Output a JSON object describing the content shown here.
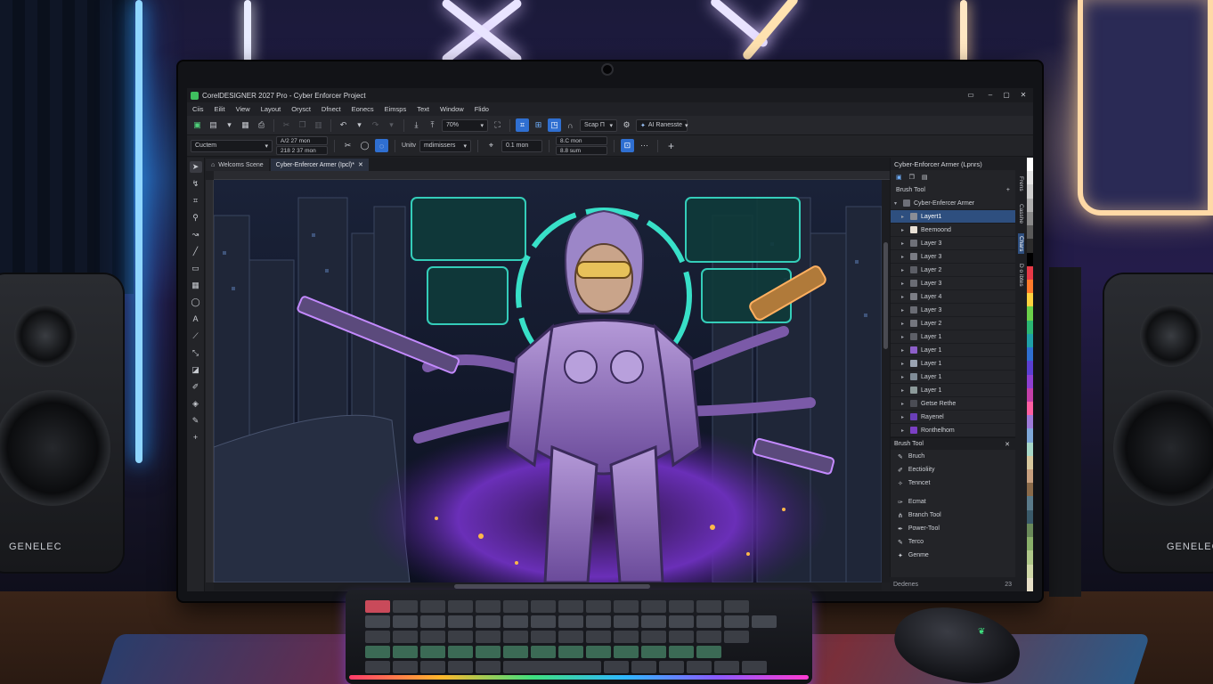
{
  "app": {
    "title": "CorelDESIGNER 2027 Pro - Cyber Enforcer Project",
    "window_controls": [
      "▭",
      "–",
      "▢",
      "✕"
    ]
  },
  "menu": [
    "Ciis",
    "Eilit",
    "View",
    "Layout",
    "Orysct",
    "Dfnect",
    "Eonecs",
    "Eimsps",
    "Text",
    "Window",
    "Flido"
  ],
  "toolbar1": {
    "zoom": "70%",
    "snap": "Scap П",
    "ai_label": "AI Ranesste"
  },
  "toolbar2": {
    "preset": "Cuctem",
    "pos_x": "A/2 27 mon",
    "pos_y": "218 2 37 mon",
    "units_label": "Unitv",
    "units_value": "mdimissers",
    "nudge": "0.1 mon",
    "size_w": "8.C mon",
    "size_h": "8.8 sum"
  },
  "tabs": {
    "welcome": "Welcoms Scene",
    "active": "Cyber-Enfercer Armer (Ipcl)*"
  },
  "panel": {
    "title": "Cyber-Enforcer Armer (Lpnrs)",
    "brush_tool_header": "Brush Tool",
    "root_layer": "Cyber-Enfercer Armer",
    "layers": [
      {
        "name": "Layert1",
        "color": "#8a8d96",
        "selected": true
      },
      {
        "name": "Beemoond",
        "color": "#e8e0d6",
        "selected": false
      },
      {
        "name": "Layer 3",
        "color": "#6e7078",
        "selected": false
      },
      {
        "name": "Layer 3",
        "color": "#7a7c84",
        "selected": false
      },
      {
        "name": "Layer 2",
        "color": "#5c5e66",
        "selected": false
      },
      {
        "name": "Layer 3",
        "color": "#6a6c74",
        "selected": false
      },
      {
        "name": "Layer 4",
        "color": "#7c7e86",
        "selected": false
      },
      {
        "name": "Layer 3",
        "color": "#6a6c74",
        "selected": false
      },
      {
        "name": "Layer 2",
        "color": "#74767e",
        "selected": false
      },
      {
        "name": "Layer 1",
        "color": "#5e6068",
        "selected": false
      },
      {
        "name": "Layer 1",
        "color": "#8d5fc9",
        "selected": false
      },
      {
        "name": "Layer 1",
        "color": "#9aa3b2",
        "selected": false
      },
      {
        "name": "Layer 1",
        "color": "#7f8c97",
        "selected": false
      },
      {
        "name": "Layer 1",
        "color": "#8c9a9a",
        "selected": false
      },
      {
        "name": "Getse Rethe",
        "color": "#4a4c54",
        "selected": false
      },
      {
        "name": "Rayenel",
        "color": "#6a3fb8",
        "selected": false
      },
      {
        "name": "Ronthelhom",
        "color": "#7b3fc4",
        "selected": false
      }
    ],
    "brush_section": "Brush Tool",
    "brush_tools": [
      {
        "label": "Bruch",
        "icon": "✎"
      },
      {
        "label": "Eectioliity",
        "icon": "✐"
      },
      {
        "label": "Tenncet",
        "icon": "✧"
      },
      {
        "label": "Ecmat",
        "icon": "✑"
      },
      {
        "label": "Branch Tool",
        "icon": "⋔"
      },
      {
        "label": "Power-Tool",
        "icon": "✒"
      },
      {
        "label": "Terco",
        "icon": "✎"
      },
      {
        "label": "Genme",
        "icon": "✦"
      }
    ],
    "status_left": "Dedenes",
    "status_right": "23"
  },
  "side_tabs": [
    "Frens",
    "Casshe",
    "Chars",
    "D o ibtes"
  ],
  "speakers": {
    "brand": "GENELEC"
  },
  "colors": {
    "accent": "#2f6fd1",
    "selection": "#2e4f7f",
    "neon_purple": "#9b5cff",
    "neon_cyan": "#38e0c8"
  },
  "palette": [
    "#ffffff",
    "#e6e6e6",
    "#cfcfcf",
    "#b0b0b0",
    "#8a8a8a",
    "#5a5a5a",
    "#2c2c2c",
    "#000000",
    "#e63946",
    "#ff7b2b",
    "#ffd23f",
    "#6bd04a",
    "#2bb673",
    "#1fa0a8",
    "#2f6fd1",
    "#5a3fd1",
    "#8e3fd1",
    "#c43fa8",
    "#ff5fa2",
    "#9e7bd8",
    "#7fa8d8",
    "#a8d8c8",
    "#d8c89e",
    "#c8a07f",
    "#8a6a4a",
    "#5a7a8a",
    "#3a5a6a",
    "#6a8a5a",
    "#8ab06a",
    "#b0c88a",
    "#d0d8a8",
    "#e8e0c8"
  ]
}
